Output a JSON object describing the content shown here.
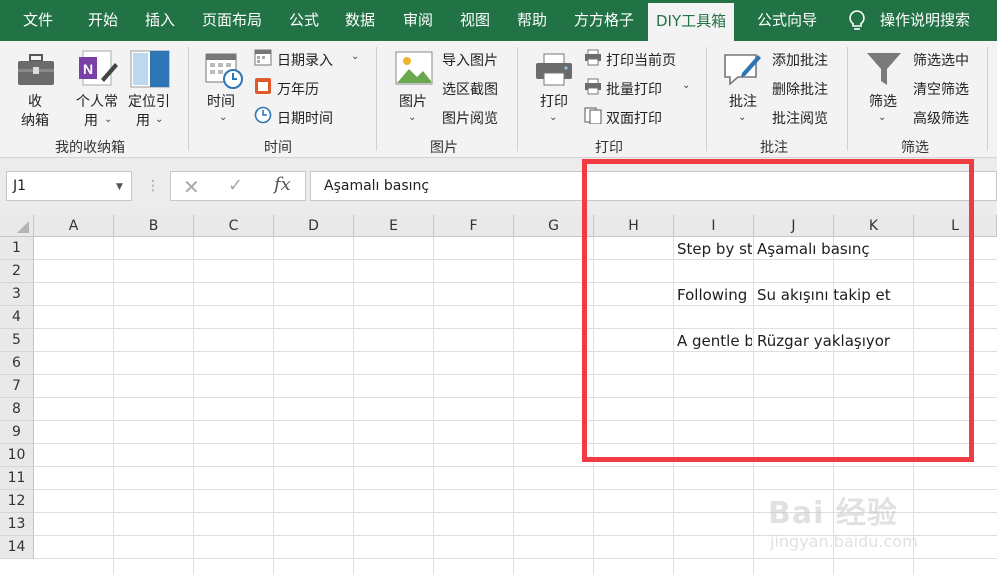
{
  "tabs": [
    "文件",
    "开始",
    "插入",
    "页面布局",
    "公式",
    "数据",
    "审阅",
    "视图",
    "帮助",
    "方方格子",
    "DIY工具箱",
    "公式向导"
  ],
  "active_tab": "DIY工具箱",
  "tell_me": "操作说明搜索",
  "ribbon": {
    "storage": {
      "box_label_1": "收",
      "box_label_2": "纳箱",
      "personal_1": "个人常",
      "personal_2": "用",
      "locate_1": "定位引",
      "locate_2": "用",
      "group": "我的收纳箱"
    },
    "time": {
      "time_btn": "时间",
      "date_entry": "日期录入",
      "calendar": "万年历",
      "datetime": "日期时间",
      "group": "时间"
    },
    "picture": {
      "pic_btn": "图片",
      "import": "导入图片",
      "capture": "选区截图",
      "browse": "图片阅览",
      "group": "图片"
    },
    "print": {
      "print_btn": "打印",
      "print_current": "打印当前页",
      "batch_print": "批量打印",
      "duplex": "双面打印",
      "group": "打印"
    },
    "comment": {
      "comment_btn": "批注",
      "add": "添加批注",
      "delete": "删除批注",
      "browse": "批注阅览",
      "group": "批注"
    },
    "filter": {
      "filter_btn": "筛选",
      "filter_selected": "筛选选中",
      "clear": "清空筛选",
      "advanced": "高级筛选",
      "group": "筛选"
    }
  },
  "formula_bar": {
    "name_box": "J1",
    "cancel_symbol": "✕",
    "enter_symbol": "✓",
    "fx_symbol": "fx",
    "formula": "Aşamalı basınç"
  },
  "columns": [
    "A",
    "B",
    "C",
    "D",
    "E",
    "F",
    "G",
    "H",
    "I",
    "J",
    "K",
    "L"
  ],
  "rows": [
    "1",
    "2",
    "3",
    "4",
    "5",
    "6",
    "7",
    "8",
    "9",
    "10",
    "11",
    "12",
    "13",
    "14"
  ],
  "cells": {
    "I1": "Step by st",
    "J1": "Aşamalı basınç",
    "I3": "Following",
    "J3": "Su akışını takip et",
    "I5": "A gentle b",
    "J5": "Rüzgar yaklaşıyor"
  },
  "watermark": {
    "line1": "Bai 经验",
    "line2": "jingyan.baidu.com"
  },
  "colors": {
    "excel_green": "#217346",
    "highlight_red": "#ef3b41",
    "ribbon_bg": "#f3f3f3"
  }
}
